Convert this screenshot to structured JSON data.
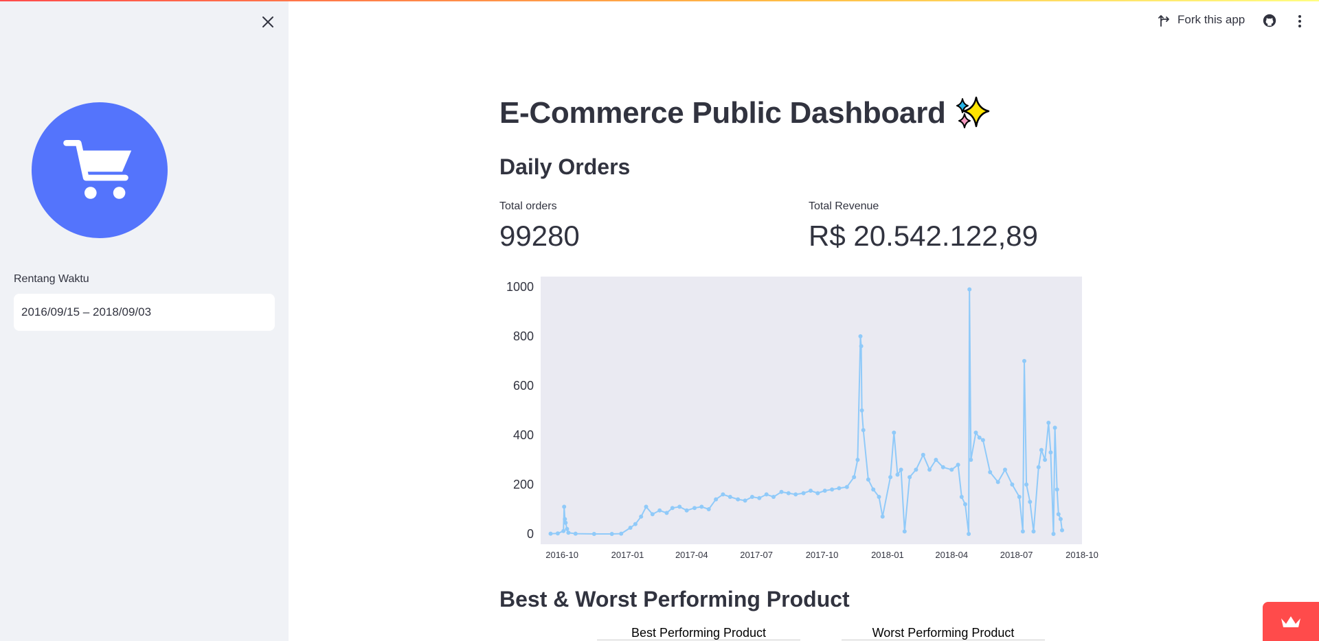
{
  "sidebar": {
    "date_label": "Rentang Waktu",
    "date_value": "2016/09/15 – 2018/09/03"
  },
  "toolbar": {
    "fork_label": "Fork this app"
  },
  "main": {
    "title": "E-Commerce Public Dashboard",
    "daily_orders_heading": "Daily Orders",
    "total_orders_label": "Total orders",
    "total_orders_value": "99280",
    "total_revenue_label": "Total Revenue",
    "total_revenue_value": "R$ 20.542.122,89",
    "best_worst_heading": "Best & Worst Performing Product",
    "best_product_label": "Best Performing Product",
    "worst_product_label": "Worst Performing Product"
  },
  "colors": {
    "accent": "#5474fc",
    "line": "#90caf9",
    "plot_bg": "#eaeaf2"
  },
  "chart_data": {
    "type": "line",
    "title": "",
    "xlabel": "",
    "ylabel": "",
    "ylim": [
      0,
      1000
    ],
    "xlim": [
      "2016-09",
      "2018-10"
    ],
    "yticks": [
      "0",
      "200",
      "400",
      "600",
      "800",
      "1000"
    ],
    "xticks": [
      "2016-10",
      "2017-01",
      "2017-04",
      "2017-07",
      "2017-10",
      "2018-01",
      "2018-04",
      "2018-07",
      "2018-10"
    ],
    "series": [
      {
        "points": [
          [
            "2016-09-15",
            1
          ],
          [
            "2016-09-25",
            2
          ],
          [
            "2016-10-03",
            12
          ],
          [
            "2016-10-04",
            110
          ],
          [
            "2016-10-05",
            60
          ],
          [
            "2016-10-06",
            45
          ],
          [
            "2016-10-08",
            20
          ],
          [
            "2016-10-10",
            5
          ],
          [
            "2016-10-20",
            1
          ],
          [
            "2016-11-15",
            0
          ],
          [
            "2016-12-10",
            0
          ],
          [
            "2016-12-23",
            1
          ],
          [
            "2017-01-05",
            25
          ],
          [
            "2017-01-12",
            40
          ],
          [
            "2017-01-20",
            70
          ],
          [
            "2017-01-27",
            110
          ],
          [
            "2017-02-05",
            80
          ],
          [
            "2017-02-15",
            95
          ],
          [
            "2017-02-25",
            85
          ],
          [
            "2017-03-05",
            105
          ],
          [
            "2017-03-15",
            110
          ],
          [
            "2017-03-25",
            95
          ],
          [
            "2017-04-05",
            105
          ],
          [
            "2017-04-15",
            110
          ],
          [
            "2017-04-25",
            100
          ],
          [
            "2017-05-05",
            140
          ],
          [
            "2017-05-15",
            160
          ],
          [
            "2017-05-25",
            150
          ],
          [
            "2017-06-05",
            140
          ],
          [
            "2017-06-15",
            135
          ],
          [
            "2017-06-25",
            150
          ],
          [
            "2017-07-05",
            145
          ],
          [
            "2017-07-15",
            160
          ],
          [
            "2017-07-25",
            150
          ],
          [
            "2017-08-05",
            170
          ],
          [
            "2017-08-15",
            165
          ],
          [
            "2017-08-25",
            160
          ],
          [
            "2017-09-05",
            165
          ],
          [
            "2017-09-15",
            175
          ],
          [
            "2017-09-25",
            165
          ],
          [
            "2017-10-05",
            175
          ],
          [
            "2017-10-15",
            180
          ],
          [
            "2017-10-25",
            185
          ],
          [
            "2017-11-05",
            190
          ],
          [
            "2017-11-15",
            230
          ],
          [
            "2017-11-20",
            300
          ],
          [
            "2017-11-24",
            800
          ],
          [
            "2017-11-25",
            760
          ],
          [
            "2017-11-26",
            500
          ],
          [
            "2017-11-28",
            420
          ],
          [
            "2017-12-05",
            220
          ],
          [
            "2017-12-12",
            180
          ],
          [
            "2017-12-20",
            150
          ],
          [
            "2017-12-25",
            70
          ],
          [
            "2018-01-05",
            230
          ],
          [
            "2018-01-10",
            410
          ],
          [
            "2018-01-15",
            240
          ],
          [
            "2018-01-20",
            260
          ],
          [
            "2018-01-25",
            10
          ],
          [
            "2018-02-01",
            230
          ],
          [
            "2018-02-10",
            260
          ],
          [
            "2018-02-20",
            320
          ],
          [
            "2018-03-01",
            260
          ],
          [
            "2018-03-10",
            300
          ],
          [
            "2018-03-20",
            270
          ],
          [
            "2018-04-01",
            260
          ],
          [
            "2018-04-10",
            280
          ],
          [
            "2018-04-15",
            150
          ],
          [
            "2018-04-20",
            120
          ],
          [
            "2018-04-25",
            0
          ],
          [
            "2018-04-26",
            990
          ],
          [
            "2018-04-28",
            300
          ],
          [
            "2018-05-05",
            410
          ],
          [
            "2018-05-10",
            390
          ],
          [
            "2018-05-15",
            380
          ],
          [
            "2018-05-25",
            250
          ],
          [
            "2018-06-05",
            210
          ],
          [
            "2018-06-15",
            260
          ],
          [
            "2018-06-25",
            200
          ],
          [
            "2018-07-05",
            150
          ],
          [
            "2018-07-10",
            10
          ],
          [
            "2018-07-12",
            700
          ],
          [
            "2018-07-15",
            200
          ],
          [
            "2018-07-20",
            130
          ],
          [
            "2018-07-25",
            10
          ],
          [
            "2018-08-01",
            270
          ],
          [
            "2018-08-05",
            340
          ],
          [
            "2018-08-10",
            300
          ],
          [
            "2018-08-15",
            450
          ],
          [
            "2018-08-18",
            330
          ],
          [
            "2018-08-22",
            0
          ],
          [
            "2018-08-24",
            430
          ],
          [
            "2018-08-27",
            180
          ],
          [
            "2018-08-29",
            80
          ],
          [
            "2018-09-01",
            60
          ],
          [
            "2018-09-03",
            15
          ]
        ]
      }
    ]
  }
}
